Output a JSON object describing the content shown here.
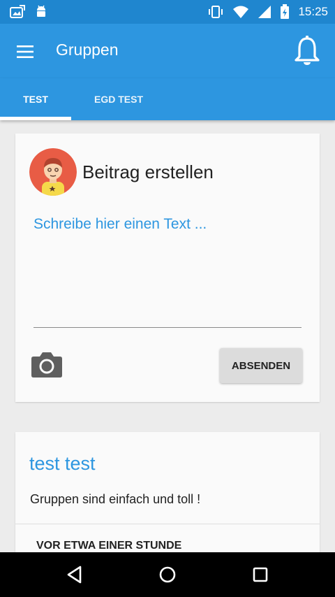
{
  "status_bar": {
    "time": "15:25",
    "icons": [
      "photo-notification-icon",
      "android-icon",
      "vibrate-icon",
      "wifi-icon",
      "signal-icon",
      "battery-icon"
    ]
  },
  "app_bar": {
    "title": "Gruppen",
    "menu_icon": "hamburger-menu-icon",
    "notification_icon": "bell-icon",
    "color": "#2d96e0"
  },
  "tabs": [
    {
      "label": "TEST",
      "selected": true
    },
    {
      "label": "EGD TEST",
      "selected": false
    }
  ],
  "compose": {
    "title": "Beitrag erstellen",
    "placeholder": "Schreibe hier einen Text ...",
    "value": "",
    "camera_icon": "camera-icon",
    "send_label": "ABSENDEN"
  },
  "post": {
    "author": "test test",
    "text": "Gruppen sind einfach und toll !",
    "time": "VOR ETWA EINER STUNDE"
  },
  "nav_bar": {
    "icons": [
      "back-icon",
      "home-icon",
      "recent-apps-icon"
    ]
  }
}
